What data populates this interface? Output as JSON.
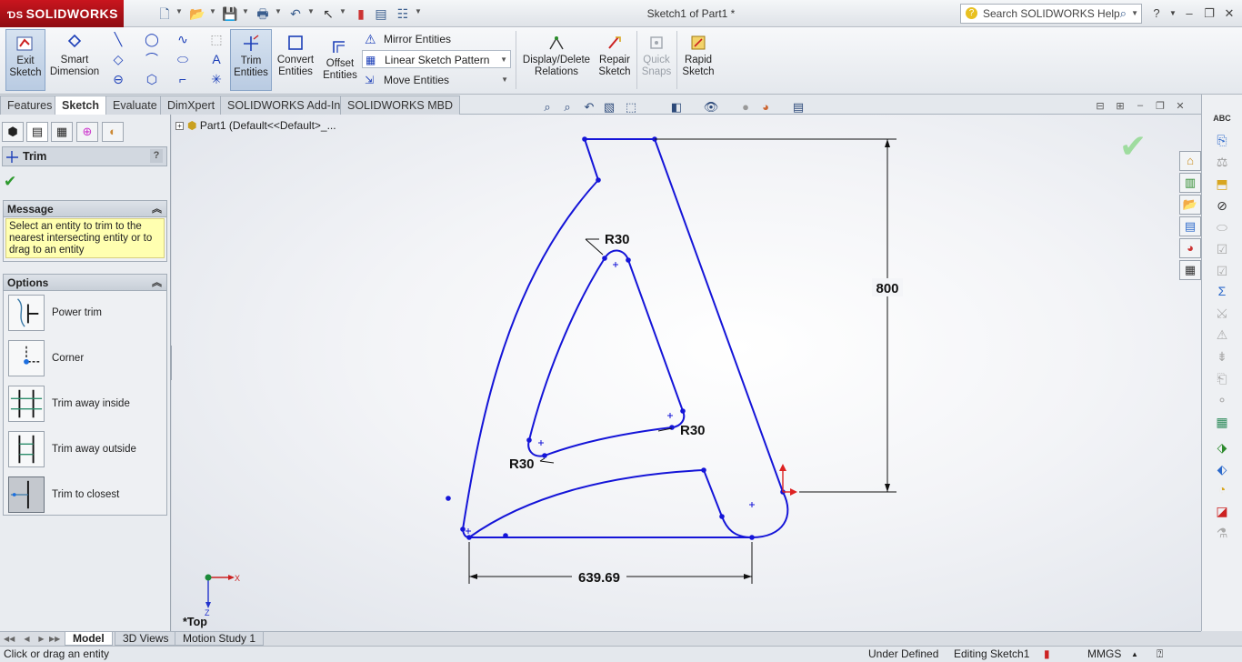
{
  "app": {
    "brand": "SOLIDWORKS",
    "document_title": "Sketch1 of Part1 *"
  },
  "search": {
    "placeholder": "Search SOLIDWORKS Help"
  },
  "ribbon": {
    "exit_sketch": "Exit Sketch",
    "smart_dimension": "Smart Dimension",
    "trim_entities": "Trim Entities",
    "convert_entities": "Convert Entities",
    "offset_entities": "Offset Entities",
    "mirror_entities": "Mirror Entities",
    "linear_sketch_pattern": "Linear Sketch Pattern",
    "move_entities": "Move Entities",
    "display_delete_relations": "Display/Delete Relations",
    "repair_sketch": "Repair Sketch",
    "quick_snaps": "Quick Snaps",
    "rapid_sketch": "Rapid Sketch"
  },
  "tabs": [
    "Features",
    "Sketch",
    "Evaluate",
    "DimXpert",
    "SOLIDWORKS Add-Ins",
    "SOLIDWORKS MBD"
  ],
  "property_manager": {
    "title": "Trim",
    "help": "?",
    "message_group": "Message",
    "message_text": "Select an entity to trim to the nearest intersecting entity or to drag to an entity",
    "options_group": "Options",
    "options": [
      "Power trim",
      "Corner",
      "Trim away inside",
      "Trim away outside",
      "Trim to closest"
    ],
    "selected_option": "Trim to closest"
  },
  "viewport": {
    "tree_root": "Part1  (Default<<Default>_...",
    "view_name": "*Top",
    "triad_x": "X",
    "triad_z": "Z"
  },
  "dimensions": {
    "height": "800",
    "width": "639.69",
    "radius_top": "R30",
    "radius_right": "R30",
    "radius_left": "R30"
  },
  "bottom_tabs": [
    "Model",
    "3D Views",
    "Motion Study 1"
  ],
  "status": {
    "hint": "Click or drag an entity",
    "definition": "Under Defined",
    "editing": "Editing Sketch1",
    "units": "MMGS"
  },
  "colors": {
    "sketch": "#1515d8",
    "dimension": "#111111",
    "accent": "#c9151e",
    "message_bg": "#ffffb0"
  }
}
